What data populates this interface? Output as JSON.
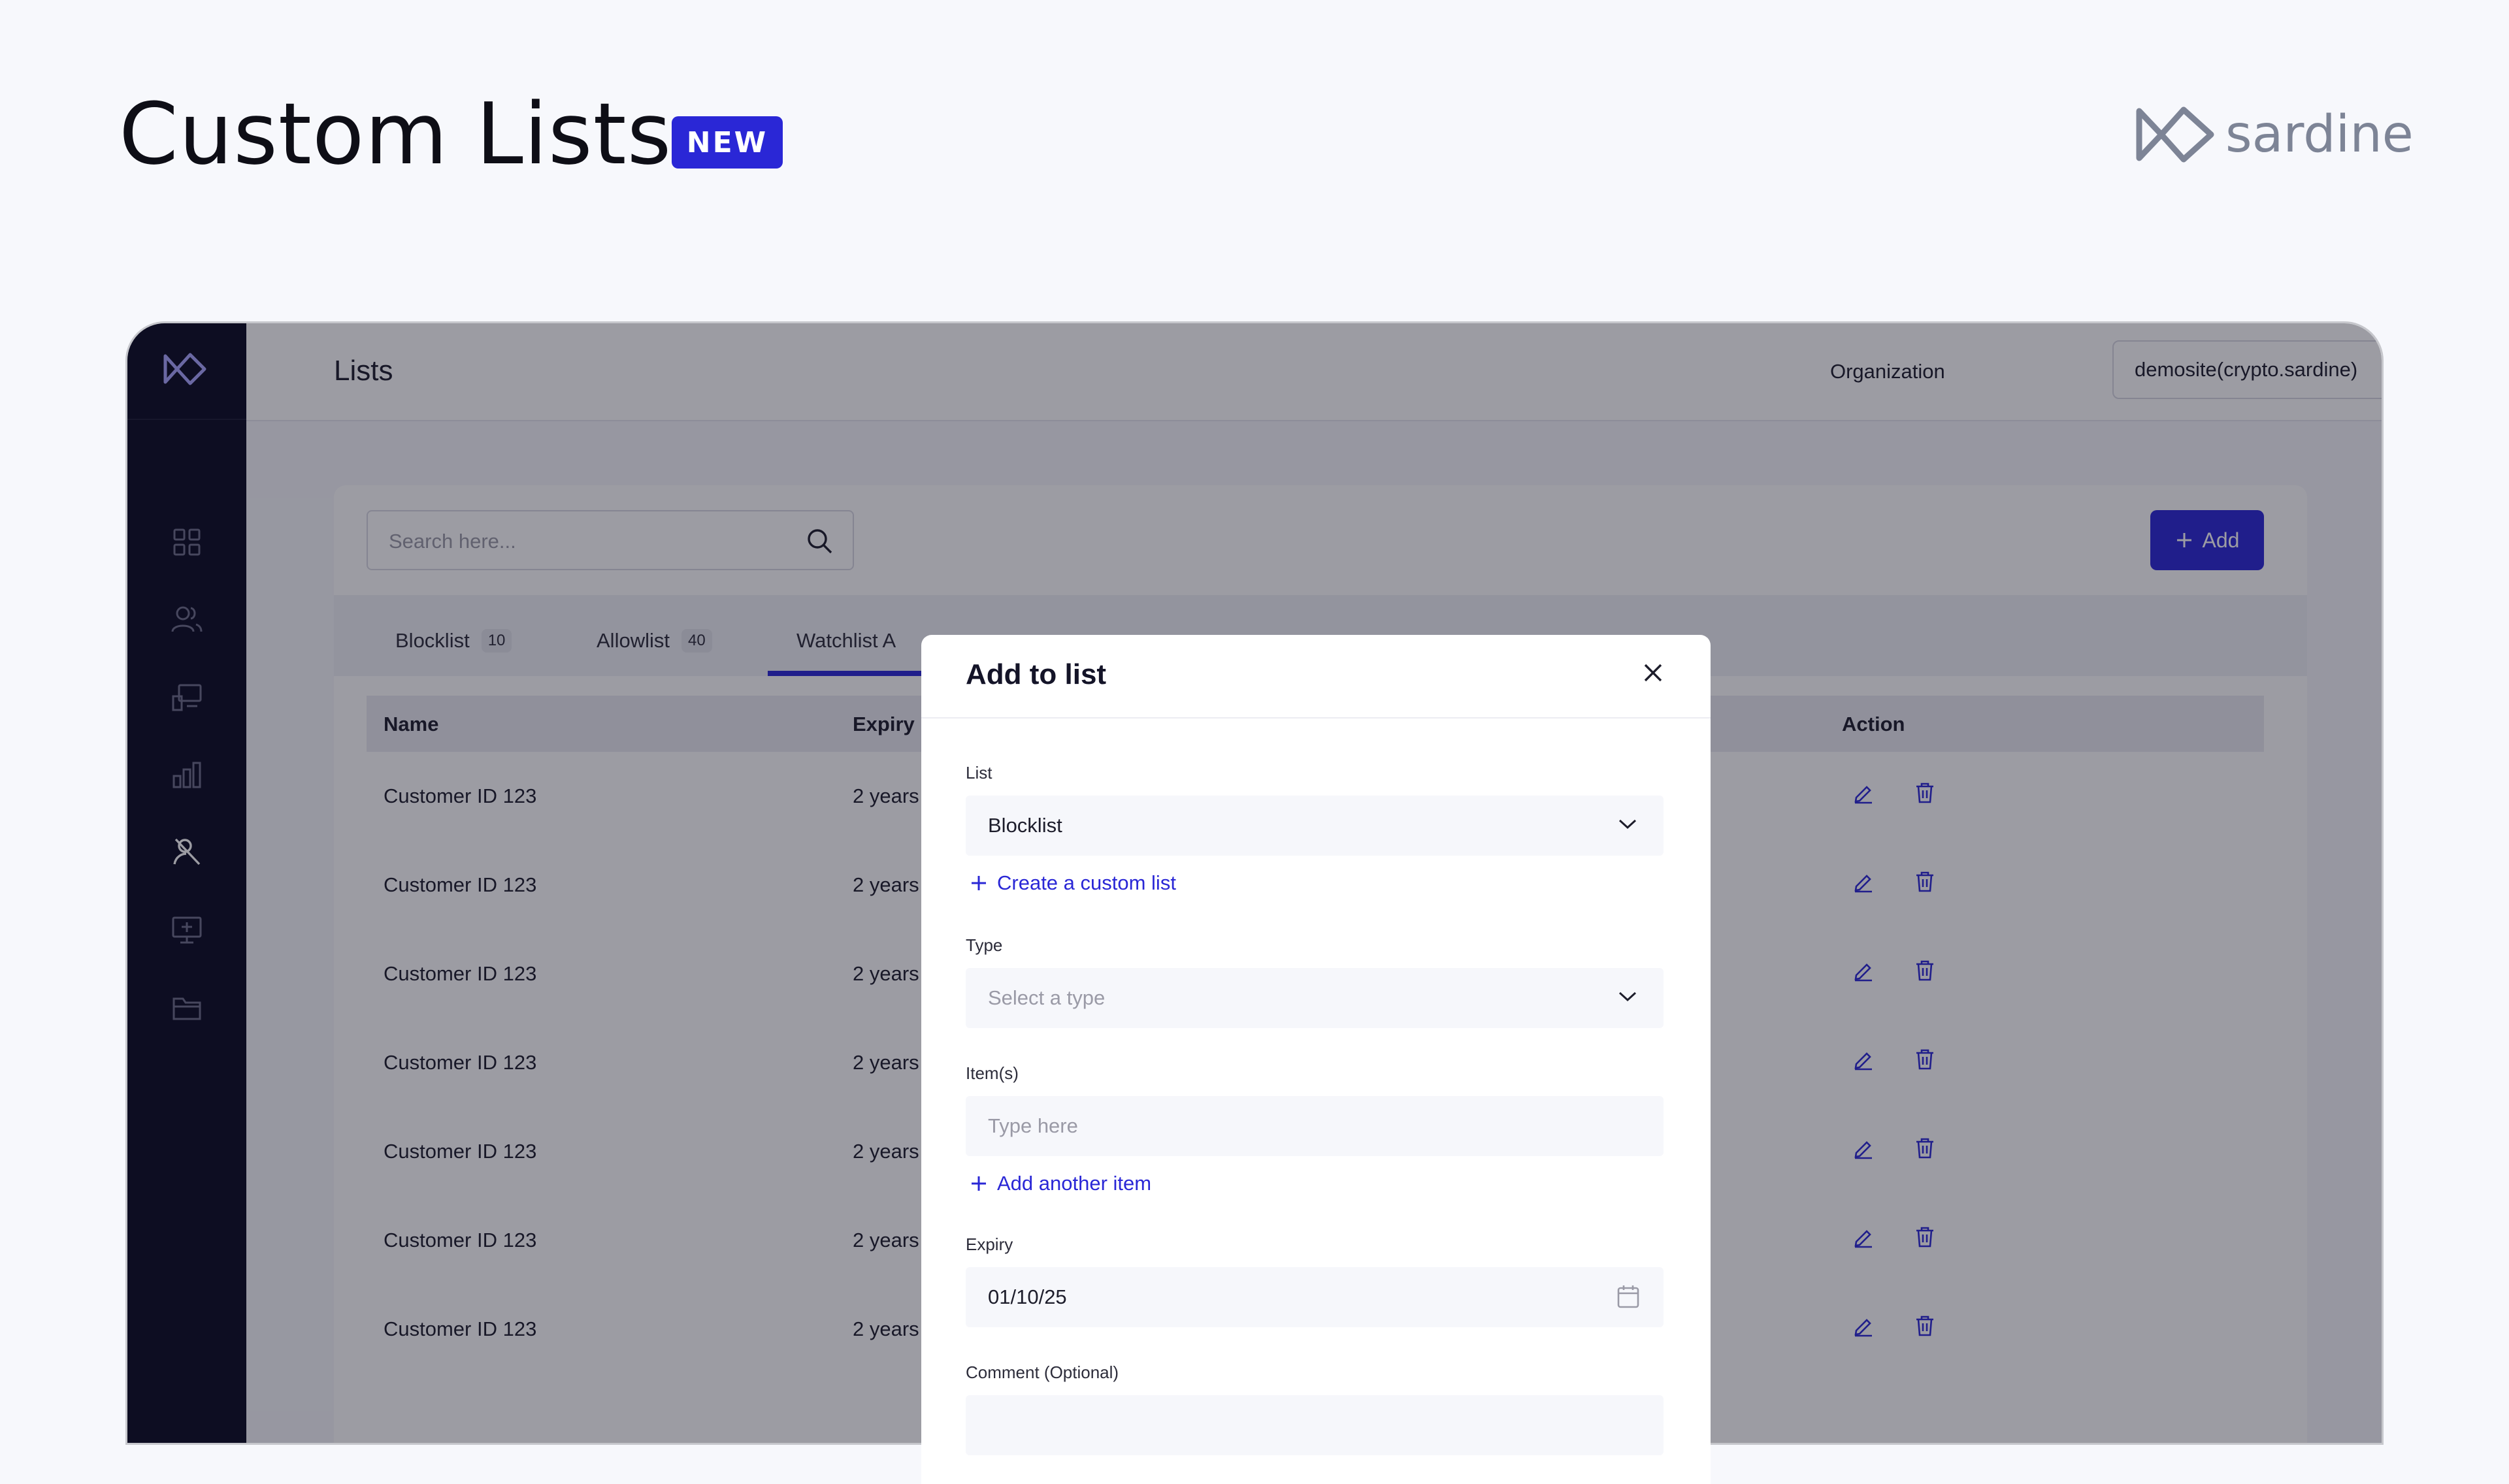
{
  "header": {
    "title": "Custom Lists",
    "badge": "NEW",
    "brand": "sardine"
  },
  "topbar": {
    "title": "Lists",
    "org_label": "Organization",
    "org_value": "demosite(crypto.sardine)"
  },
  "toolbar": {
    "search_placeholder": "Search here...",
    "add_label": "Add"
  },
  "tabs": [
    {
      "label": "Blocklist",
      "count": "10"
    },
    {
      "label": "Allowlist",
      "count": "40"
    },
    {
      "label": "Watchlist A",
      "count": ""
    }
  ],
  "table": {
    "columns": [
      "Name",
      "Expiry",
      "Action"
    ],
    "rows": [
      {
        "name": "Customer ID 123",
        "expiry": "2 years"
      },
      {
        "name": "Customer ID 123",
        "expiry": "2 years"
      },
      {
        "name": "Customer ID 123",
        "expiry": "2 years"
      },
      {
        "name": "Customer ID 123",
        "expiry": "2 years"
      },
      {
        "name": "Customer ID 123",
        "expiry": "2 years"
      },
      {
        "name": "Customer ID 123",
        "expiry": "2 years"
      },
      {
        "name": "Customer ID 123",
        "expiry": "2 years"
      }
    ]
  },
  "modal": {
    "title": "Add to list",
    "list_label": "List",
    "list_value": "Blocklist",
    "create_link": "Create a custom list",
    "type_label": "Type",
    "type_placeholder": "Select a type",
    "items_label": "Item(s)",
    "items_placeholder": "Type here",
    "add_item_link": "Add another item",
    "expiry_label": "Expiry",
    "expiry_value": "01/10/25",
    "comment_label": "Comment (Optional)"
  },
  "colors": {
    "accent": "#2a27d6",
    "sidebar": "#0a0a22",
    "brand_gray": "#7d8496"
  },
  "icons": [
    "brand-logo-icon",
    "dashboard-icon",
    "users-icon",
    "monitor-icon",
    "chart-icon",
    "lists-icon",
    "screen-add-icon",
    "folder-icon",
    "search-icon",
    "plus-icon",
    "edit-icon",
    "delete-icon",
    "close-icon",
    "chevron-down-icon",
    "calendar-icon"
  ]
}
